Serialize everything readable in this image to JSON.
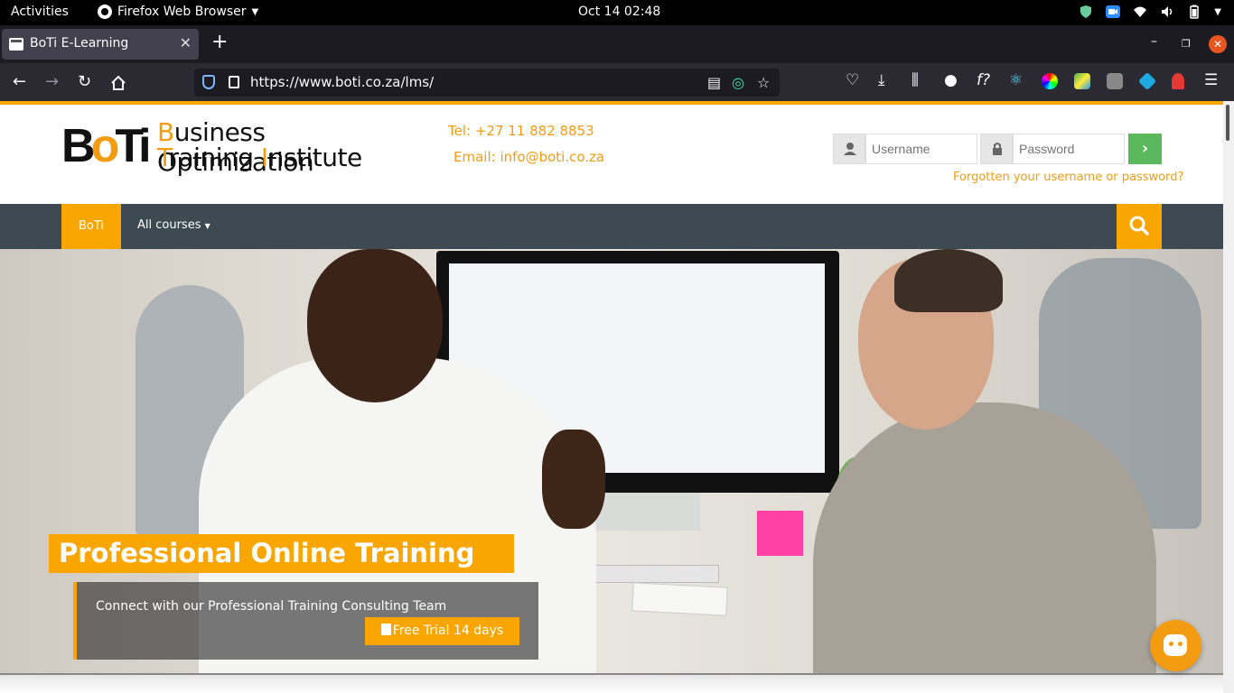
{
  "system": {
    "activities": "Activities",
    "app_name": "Firefox Web Browser",
    "clock": "Oct 14  02:48"
  },
  "browser": {
    "tab_title": "BoTi E-Learning",
    "url": "https://www.boti.co.za/lms/"
  },
  "site": {
    "logo": {
      "wordmark": "BoTi",
      "line1_cap": "B",
      "line1_rest": "usiness Optimization",
      "line2_cap1": "T",
      "line2_mid": "raining ",
      "line2_cap2": "I",
      "line2_rest": "nstitute"
    },
    "contact": {
      "tel": "Tel: +27 11 882  8853",
      "email": "Email: info@boti.co.za"
    },
    "login": {
      "username_placeholder": "Username",
      "password_placeholder": "Password",
      "forgot": "Forgotten your username or password?"
    },
    "nav": {
      "home": "BoTi",
      "courses": "All courses"
    },
    "hero": {
      "headline": "Professional Online Training",
      "caption": "Connect with our Professional Training Consulting Team",
      "cta": "Free Trial 14 days"
    }
  },
  "colors": {
    "accent": "#f9a602",
    "nav_bg": "#3d4a52",
    "login_go": "#5cb85c"
  }
}
